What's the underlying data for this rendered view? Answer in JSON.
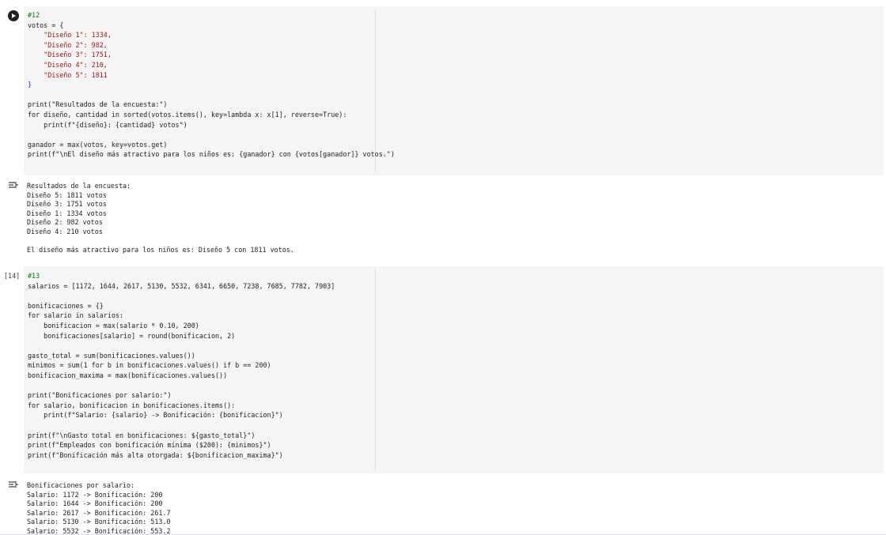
{
  "cell12": {
    "run_label": "Run cell",
    "lines": [
      "#12",
      "votos = {",
      "    \"Diseño 1\": 1334,",
      "    \"Diseño 2\": 982,",
      "    \"Diseño 3\": 1751,",
      "    \"Diseño 4\": 210,",
      "    \"Diseño 5\": 1811",
      "}",
      "",
      "print(\"Resultados de la encuesta:\")",
      "for diseño, cantidad in sorted(votos.items(), key=lambda x: x[1], reverse=True):",
      "    print(f\"{diseño}: {cantidad} votos\")",
      "",
      "ganador = max(votos, key=votos.get)",
      "print(f\"\\nEl diseño más atractivo para los niños es: {ganador} con {votos[ganador]} votos.\")"
    ],
    "output_lines": [
      "Resultados de la encuesta:",
      "Diseño 5: 1811 votos",
      "Diseño 3: 1751 votos",
      "Diseño 1: 1334 votos",
      "Diseño 2: 982 votos",
      "Diseño 4: 210 votos",
      "",
      "El diseño más atractivo para los niños es: Diseño 5 con 1811 votos."
    ]
  },
  "cell13": {
    "exec_count": "[14]",
    "lines": [
      "#13",
      "salarios = [1172, 1644, 2617, 5130, 5532, 6341, 6650, 7238, 7685, 7782, 7903]",
      "",
      "bonificaciones = {}",
      "for salario in salarios:",
      "    bonificacion = max(salario * 0.10, 200)",
      "    bonificaciones[salario] = round(bonificacion, 2)",
      "",
      "gasto_total = sum(bonificaciones.values())",
      "minimos = sum(1 for b in bonificaciones.values() if b == 200)",
      "bonificacion_maxima = max(bonificaciones.values())",
      "",
      "print(\"Bonificaciones por salario:\")",
      "for salario, bonificacion in bonificaciones.items():",
      "    print(f\"Salario: {salario} -> Bonificación: {bonificacion}\")",
      "",
      "print(f\"\\nGasto total en bonificaciones: ${gasto_total}\")",
      "print(f\"Empleados con bonificación mínima ($200): {minimos}\")",
      "print(f\"Bonificación más alta otorgada: ${bonificacion_maxima}\")"
    ],
    "output_lines": [
      "Bonificaciones por salario:",
      "Salario: 1172 -> Bonificación: 200",
      "Salario: 1644 -> Bonificación: 200",
      "Salario: 2617 -> Bonificación: 261.7",
      "Salario: 5130 -> Bonificación: 513.0",
      "Salario: 5532 -> Bonificación: 553.2"
    ]
  }
}
